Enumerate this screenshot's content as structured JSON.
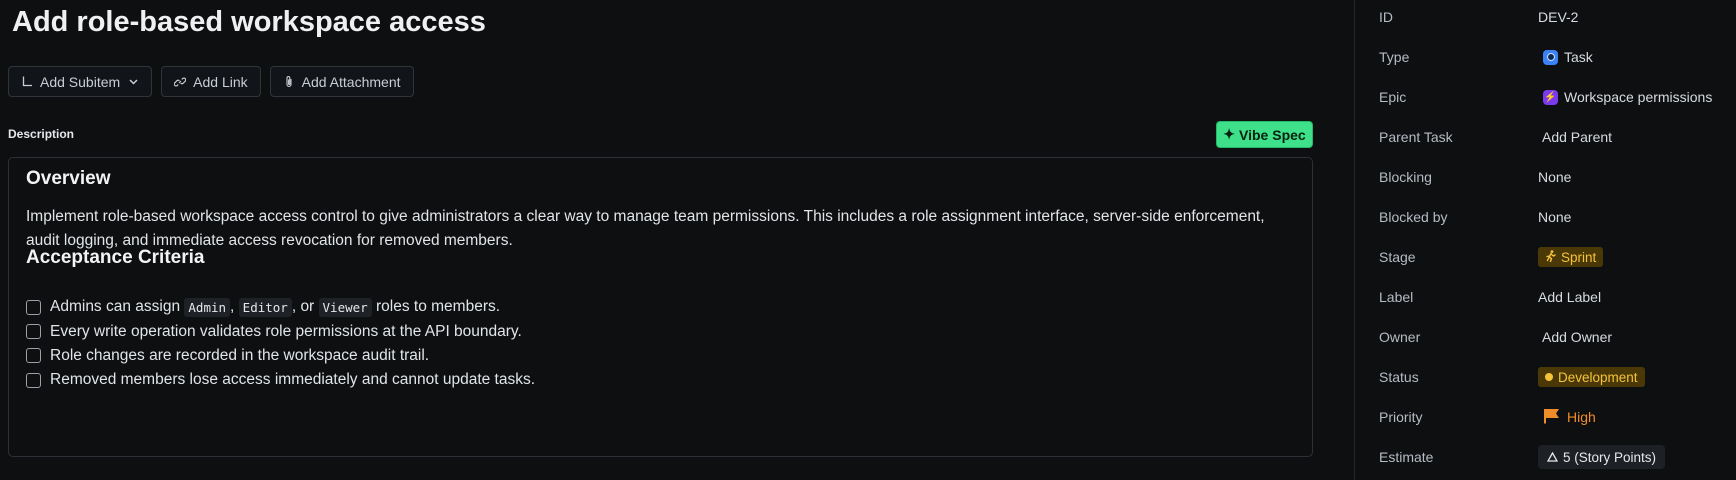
{
  "task": {
    "title": "Add role-based workspace access"
  },
  "actions": {
    "add_subitem": "Add Subitem",
    "add_link": "Add Link",
    "add_attachment": "Add Attachment"
  },
  "description": {
    "label": "Description",
    "vibe_spec": "Vibe Spec",
    "overview_heading": "Overview",
    "overview_text": "Implement role-based workspace access control to give administrators a clear way to manage team permissions. This includes a role assignment interface, server-side enforcement, audit logging, and immediate access revocation for removed members.",
    "criteria_heading": "Acceptance Criteria",
    "criteria": {
      "c1_prefix": "Admins can assign ",
      "c1_code1": "Admin",
      "c1_sep1": ", ",
      "c1_code2": "Editor",
      "c1_sep2": ", or ",
      "c1_code3": "Viewer",
      "c1_suffix": " roles to members.",
      "c2": "Every write operation validates role permissions at the API boundary.",
      "c3": "Role changes are recorded in the workspace audit trail.",
      "c4": "Removed members lose access immediately and cannot update tasks."
    }
  },
  "properties": {
    "id": {
      "label": "ID",
      "value": "DEV-2"
    },
    "type": {
      "label": "Type",
      "value": "Task",
      "icon": "task-icon"
    },
    "epic": {
      "label": "Epic",
      "value": "Workspace permissions",
      "icon": "epic-bolt-icon"
    },
    "parent": {
      "label": "Parent Task",
      "value": "Add Parent"
    },
    "blocking": {
      "label": "Blocking",
      "value": "None"
    },
    "blocked_by": {
      "label": "Blocked by",
      "value": "None"
    },
    "stage": {
      "label": "Stage",
      "value": "Sprint",
      "icon": "running-person-icon"
    },
    "label": {
      "label": "Label",
      "value": "Add Label"
    },
    "owner": {
      "label": "Owner",
      "value": "Add Owner"
    },
    "status": {
      "label": "Status",
      "value": "Development"
    },
    "priority": {
      "label": "Priority",
      "value": "High",
      "icon": "flag-icon"
    },
    "estimate": {
      "label": "Estimate",
      "value": "5 (Story Points)",
      "icon": "triangle-icon"
    }
  },
  "colors": {
    "background": "#0d0f11",
    "vibe_spec": "#3fe08a",
    "stage_status_text": "#f5c33b",
    "priority": "#f08c2a",
    "type_icon": "#3b82f6",
    "epic_icon": "#7c3aed"
  }
}
